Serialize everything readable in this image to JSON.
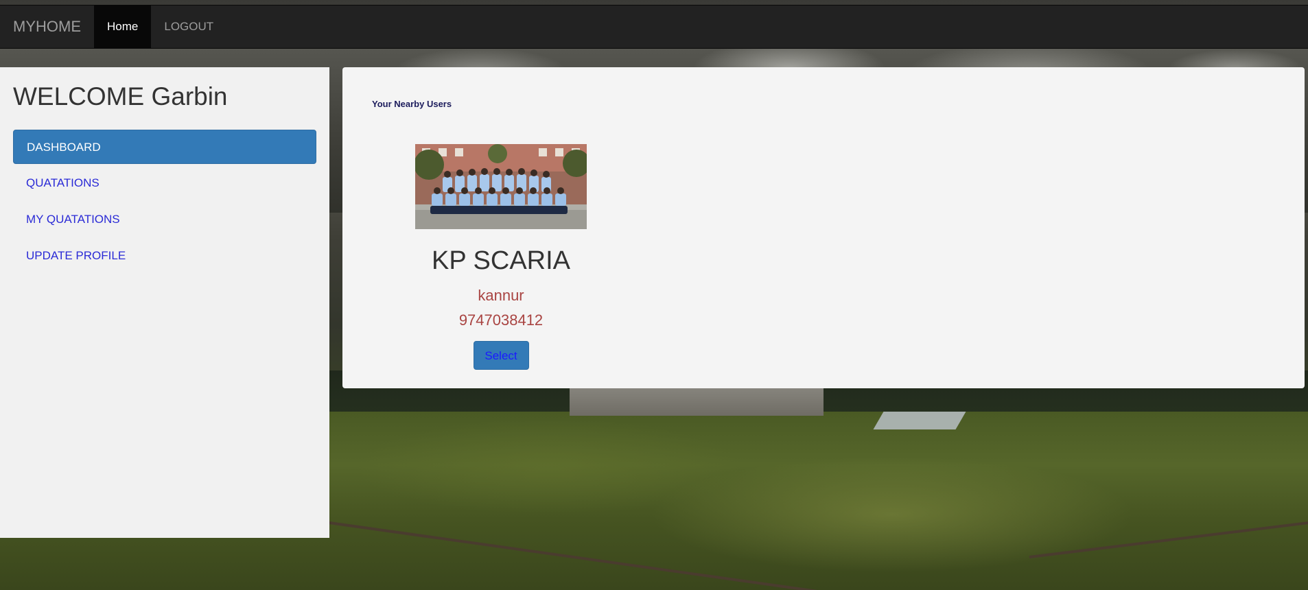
{
  "navbar": {
    "brand": "MYHOME",
    "links": [
      {
        "label": "Home",
        "active": true
      },
      {
        "label": "LOGOUT",
        "active": false
      }
    ]
  },
  "sidebar": {
    "welcome": "WELCOME Garbin",
    "items": [
      {
        "label": "DASHBOARD",
        "active": true
      },
      {
        "label": "QUATATIONS",
        "active": false
      },
      {
        "label": "MY QUATATIONS",
        "active": false
      },
      {
        "label": "UPDATE PROFILE",
        "active": false
      }
    ]
  },
  "main": {
    "section_title": "Your Nearby Users",
    "users": [
      {
        "name": "KP SCARIA",
        "location": "kannur",
        "phone": "9747038412",
        "button_label": "Select"
      }
    ]
  },
  "colors": {
    "navbar_bg": "#222222",
    "primary": "#337ab7",
    "link": "#2a2ad6",
    "danger_text": "#a94442"
  }
}
